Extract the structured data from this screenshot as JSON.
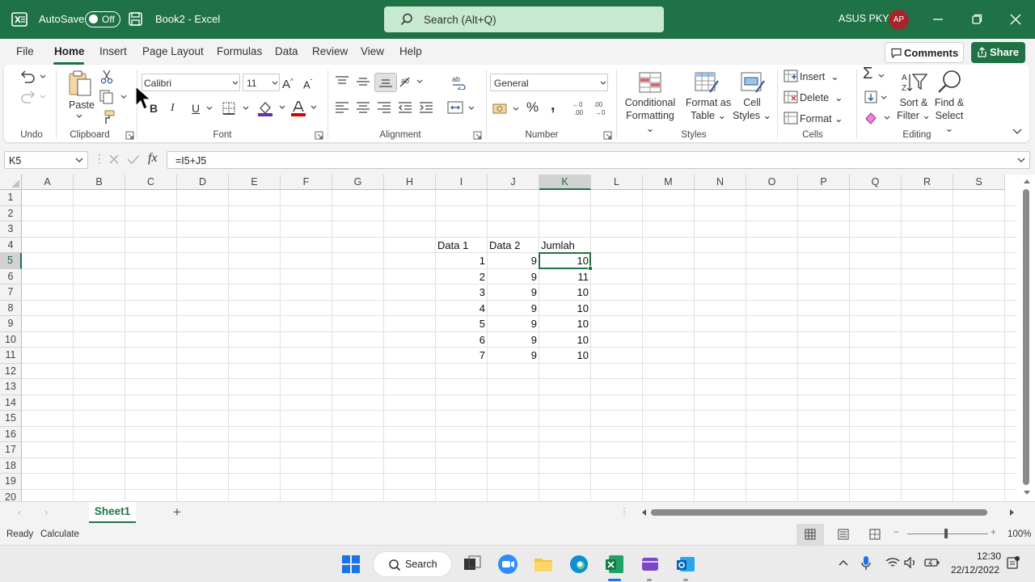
{
  "titlebar": {
    "autosave": "AutoSave",
    "toggle_state": "Off",
    "doc_name": "Book2  -  Excel",
    "search_placeholder": "Search (Alt+Q)",
    "user_name": "ASUS PKY",
    "avatar_initials": "AP"
  },
  "menu": {
    "tabs": [
      "File",
      "Home",
      "Insert",
      "Page Layout",
      "Formulas",
      "Data",
      "Review",
      "View",
      "Help"
    ],
    "comments": "Comments",
    "share": "Share"
  },
  "ribbon": {
    "groups": {
      "undo": "Undo",
      "clipboard": "Clipboard",
      "font": "Font",
      "alignment": "Alignment",
      "number": "Number",
      "styles": "Styles",
      "cells": "Cells",
      "editing": "Editing"
    },
    "paste": "Paste",
    "font_name": "Calibri",
    "font_size": "11",
    "number_format": "General",
    "conditional_formatting": [
      "Conditional",
      "Formatting"
    ],
    "format_as_table": [
      "Format as",
      "Table"
    ],
    "cell_styles": [
      "Cell",
      "Styles"
    ],
    "insert": "Insert",
    "delete": "Delete",
    "format": "Format",
    "sort_filter": [
      "Sort &",
      "Filter"
    ],
    "find_select": [
      "Find &",
      "Select"
    ],
    "bold": "B",
    "italic": "I",
    "underline": "U"
  },
  "formula_bar": {
    "name_box": "K5",
    "formula": "=I5+J5",
    "fx": "fx"
  },
  "sheet": {
    "columns": [
      "A",
      "B",
      "C",
      "D",
      "E",
      "F",
      "G",
      "H",
      "I",
      "J",
      "K",
      "L",
      "M",
      "N",
      "O",
      "P",
      "Q",
      "R",
      "S"
    ],
    "rows": [
      "1",
      "2",
      "3",
      "4",
      "5",
      "6",
      "7",
      "8",
      "9",
      "10",
      "11",
      "12",
      "13",
      "14",
      "15",
      "16",
      "17",
      "18",
      "19",
      "20"
    ],
    "selected_cell": "K5",
    "headers": {
      "I4": "Data 1",
      "J4": "Data 2",
      "K4": "Jumlah"
    },
    "data_1": [
      "1",
      "2",
      "3",
      "4",
      "5",
      "6",
      "7"
    ],
    "data_2": [
      "9",
      "9",
      "9",
      "9",
      "9",
      "9",
      "9"
    ],
    "jumlah": [
      "10",
      "11",
      "10",
      "10",
      "10",
      "10",
      "10"
    ]
  },
  "sheet_tabs": {
    "active": "Sheet1",
    "add": "+"
  },
  "status": {
    "ready": "Ready",
    "calculate": "Calculate",
    "zoom": "100%"
  },
  "taskbar": {
    "search": "Search",
    "time": "12:30",
    "date": "22/12/2022"
  },
  "colors": {
    "excel_green": "#1f7245",
    "search_bg": "#c7e8d1",
    "avatar": "#a4262c"
  }
}
